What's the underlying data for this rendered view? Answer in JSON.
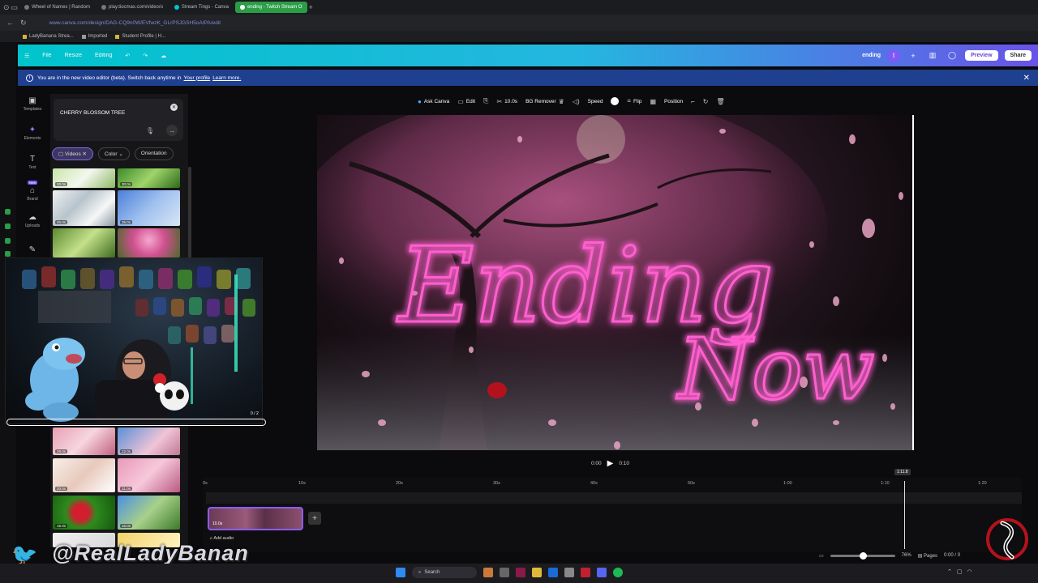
{
  "browser": {
    "tabs": [
      {
        "label": "Wheel of Names | Random",
        "active": false
      },
      {
        "label": "play.tiocmax.com/video/o",
        "active": false
      },
      {
        "label": "Stream Tings - Canva",
        "active": false
      },
      {
        "label": "ending - Twitch Stream O",
        "active": true
      }
    ],
    "url": "www.canva.com/design/DAG-CQ9n0W/EVfwzK_GLrPSJGSH5oAIPA/edit",
    "bookmarks": [
      "LadyBanana Strea...",
      "Imported",
      "Student Profile | H..."
    ]
  },
  "canva_bar": {
    "menu": [
      "File",
      "Resize",
      "Editing"
    ],
    "project_name": "ending",
    "avatar_letter": "t",
    "preview_label": "Preview",
    "share_label": "Share"
  },
  "banner": {
    "text": "You are in the new video editor (beta). Switch back anytime in",
    "link1": "Your profile",
    "link2": "Learn more."
  },
  "rail": [
    {
      "label": "Templates",
      "icon": "templates-icon"
    },
    {
      "label": "Elements",
      "icon": "elements-icon"
    },
    {
      "label": "Text",
      "icon": "text-icon"
    },
    {
      "label": "Brand",
      "icon": "brand-icon",
      "badge": "New"
    },
    {
      "label": "Uploads",
      "icon": "uploads-icon"
    }
  ],
  "panel": {
    "search_query": "CHERRY BLOSSOM TREE",
    "filters": [
      "Videos",
      "Color",
      "Orientation"
    ],
    "thumbs_top": [
      "30.0s",
      "30.0s",
      "45.0s",
      "35.0s",
      "",
      ""
    ],
    "thumbs_bottom": [
      "29.0s",
      "22.0s",
      "20.0s",
      "21.0s",
      "15.0s",
      "15.0s"
    ]
  },
  "webcam": {
    "counter": "0 / 2"
  },
  "editor_toolbar": {
    "ask_canva": "Ask Canva",
    "edit": "Edit",
    "duration": "10.0s",
    "bg_remover": "BG Remover",
    "speed": "Speed",
    "flip": "Flip",
    "position": "Position"
  },
  "canvas": {
    "title_line1": "Ending",
    "title_line2": "Now"
  },
  "playback": {
    "current": "0:00",
    "total": "0:10"
  },
  "timeline": {
    "ticks": [
      "0s",
      "10s",
      "20s",
      "30s",
      "40s",
      "50s",
      "1:00",
      "1:10",
      "1:20"
    ],
    "clip_duration": "10.0s",
    "add_audio": "Add audio",
    "playhead_label": "1:11.8"
  },
  "bottom": {
    "zoom": "76%",
    "pages_label": "Pages",
    "time": "0:00 / 0"
  },
  "watermark": {
    "handle": "@RealLadyBanan"
  },
  "taskbar": {
    "search_label": "Search"
  },
  "colors": {
    "canva_gradient_start": "#00c4cc",
    "canva_gradient_end": "#6a52e8",
    "neon_pink": "#ff4fc3",
    "banner_blue": "#1f3f8f"
  }
}
